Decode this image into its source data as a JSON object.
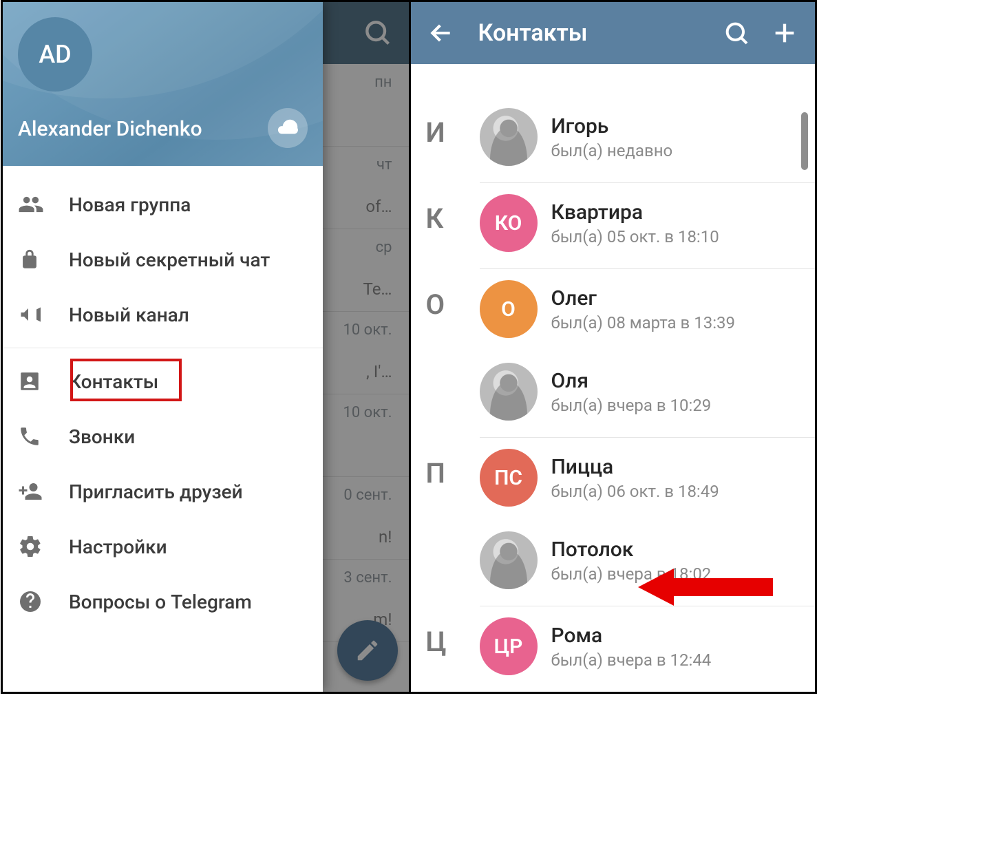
{
  "left": {
    "drawer": {
      "avatar_initials": "AD",
      "user_name": "Alexander Dichenko",
      "menu": {
        "new_group": "Новая группа",
        "new_secret_chat": "Новый секретный чат",
        "new_channel": "Новый канал",
        "contacts": "Контакты",
        "calls": "Звонки",
        "invite_friends": "Пригласить друзей",
        "settings": "Настройки",
        "faq": "Вопросы о Telegram"
      }
    },
    "chatlist": {
      "rows": [
        {
          "day": "пн",
          "snippet": ""
        },
        {
          "day": "чт",
          "snippet": "of…"
        },
        {
          "day": "ср",
          "snippet": "Te…"
        },
        {
          "day": "10 окт.",
          "snippet": ", I'…"
        },
        {
          "day": "10 окт.",
          "snippet": ""
        },
        {
          "day": "0 сент.",
          "snippet": "n!"
        },
        {
          "day": "3 сент.",
          "snippet": "m!"
        }
      ]
    },
    "highlight": {
      "target": "contacts"
    }
  },
  "right": {
    "appbar": {
      "title": "Контакты"
    },
    "sections": [
      {
        "index": "И",
        "contacts": [
          {
            "name": "Игорь",
            "status": "был(а) недавно",
            "avatar": {
              "type": "photo"
            }
          }
        ]
      },
      {
        "index": "К",
        "contacts": [
          {
            "name": "Квартира",
            "status": "был(а) 05 окт. в 18:10",
            "avatar": {
              "type": "initials",
              "text": "КО",
              "bg": "#e8638f"
            }
          }
        ]
      },
      {
        "index": "О",
        "contacts": [
          {
            "name": "Олег",
            "status": "был(а) 08 марта в 13:39",
            "avatar": {
              "type": "initials",
              "text": "О",
              "bg": "#ed9342"
            }
          },
          {
            "name": "Оля",
            "status": "был(а) вчера в 10:29",
            "avatar": {
              "type": "photo"
            }
          }
        ]
      },
      {
        "index": "П",
        "contacts": [
          {
            "name": "Пицца",
            "status": "был(а) 06 окт. в 18:49",
            "avatar": {
              "type": "initials",
              "text": "ПС",
              "bg": "#e26a58"
            }
          },
          {
            "name": "Потолок",
            "status": "был(а) вчера в 18:02",
            "avatar": {
              "type": "photo"
            }
          }
        ]
      },
      {
        "index": "Ц",
        "contacts": [
          {
            "name": "Рома",
            "status": "был(а) вчера в 12:44",
            "avatar": {
              "type": "initials",
              "text": "ЦР",
              "bg": "#e8638f"
            }
          }
        ]
      }
    ],
    "arrow": {
      "target_contact": "Потолок",
      "color": "#e60000"
    }
  }
}
